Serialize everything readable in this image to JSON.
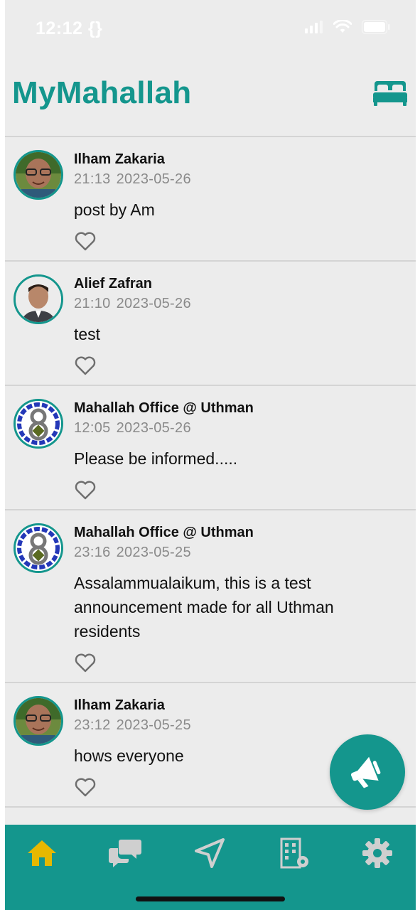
{
  "status_bar": {
    "time": "12:12 {}"
  },
  "header": {
    "title": "MyMahallah",
    "action_icon": "bed-icon"
  },
  "colors": {
    "accent": "#14968d",
    "background": "#ececec",
    "active_nav": "#e6b800",
    "inactive_nav": "#cfcfcf"
  },
  "posts": [
    {
      "author": "Ilham Zakaria",
      "time": "21:13",
      "date": "2023-05-26",
      "text": "post by Am"
    },
    {
      "author": "Alief Zafran",
      "time": "21:10",
      "date": "2023-05-26",
      "text": "test"
    },
    {
      "author": "Mahallah Office @ Uthman",
      "time": "12:05",
      "date": "2023-05-26",
      "text": "Please be informed....."
    },
    {
      "author": "Mahallah Office @ Uthman",
      "time": "23:16",
      "date": "2023-05-25",
      "text": "Assalammualaikum, this is a test announcement made for all Uthman residents"
    },
    {
      "author": "Ilham Zakaria",
      "time": "23:12",
      "date": "2023-05-25",
      "text": "hows everyone"
    }
  ],
  "fab": {
    "icon": "megaphone-icon"
  },
  "bottom_nav": [
    {
      "name": "home",
      "icon": "home-icon",
      "active": true
    },
    {
      "name": "chat",
      "icon": "chat-icon",
      "active": false
    },
    {
      "name": "navigate",
      "icon": "navigation-arrow-icon",
      "active": false
    },
    {
      "name": "building",
      "icon": "building-settings-icon",
      "active": false
    },
    {
      "name": "settings",
      "icon": "gear-icon",
      "active": false
    }
  ]
}
